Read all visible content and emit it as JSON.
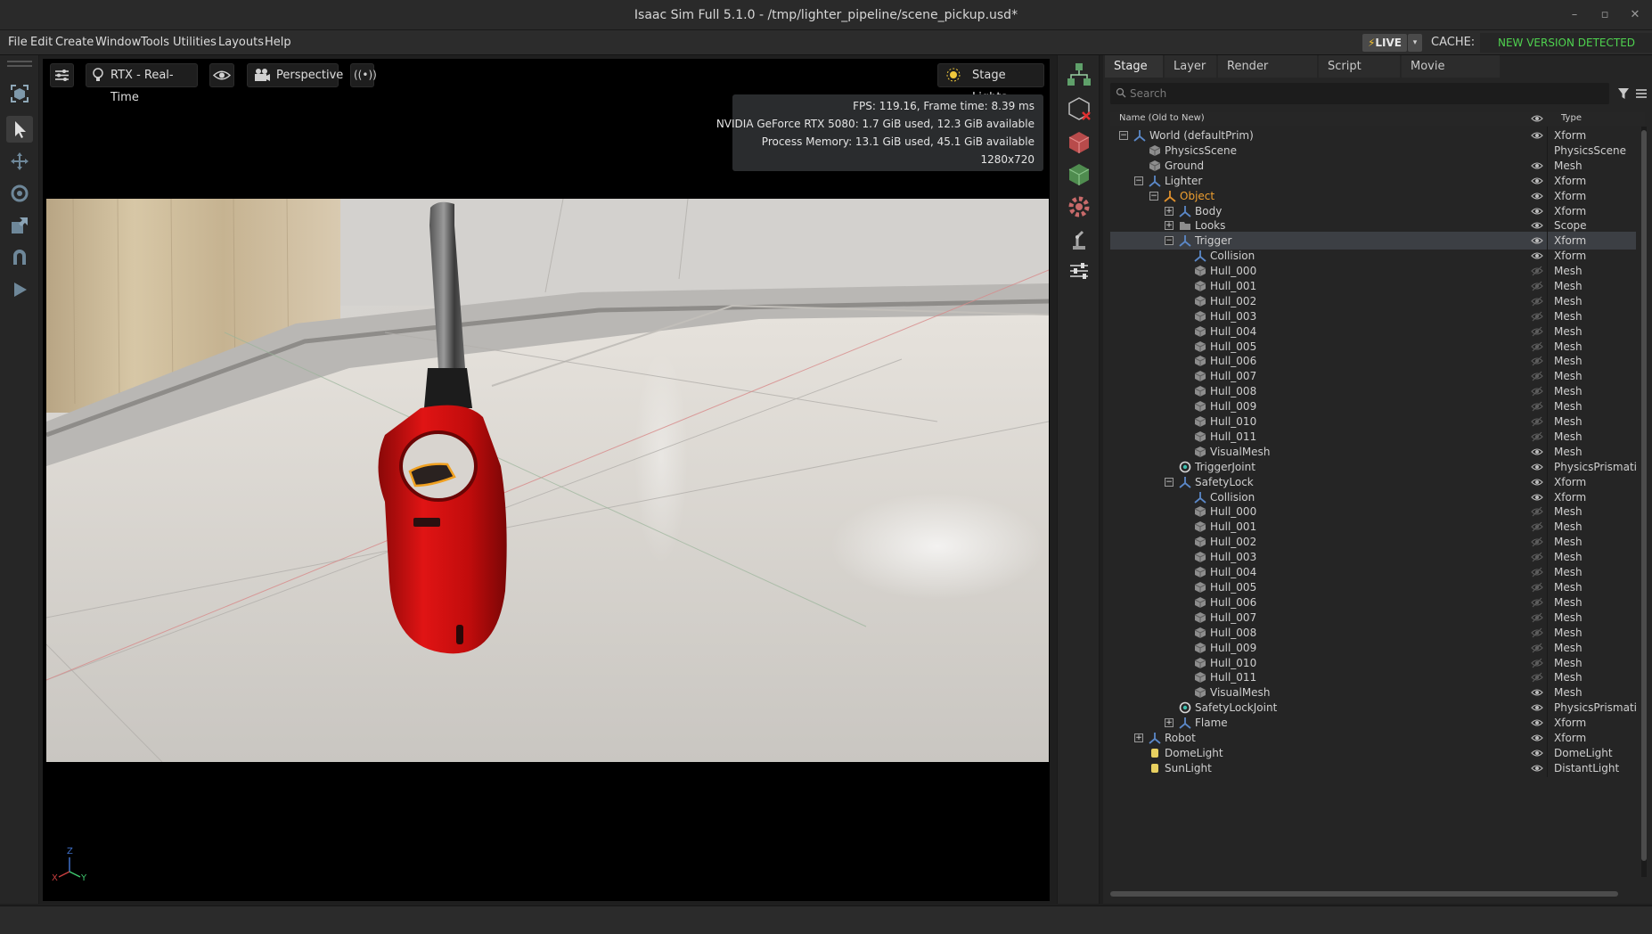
{
  "window": {
    "title": "Isaac Sim Full 5.1.0 - /tmp/lighter_pipeline/scene_pickup.usd*",
    "minimize": "–",
    "maximize": "▫",
    "close": "✕"
  },
  "menu": [
    "File",
    "Edit",
    "Create",
    "Window",
    "Tools",
    "Utilities",
    "Layouts",
    "Help"
  ],
  "live": {
    "label": "LIVE",
    "caret": "▾"
  },
  "cache": {
    "label": "CACHE:",
    "status": "NEW VERSION DETECTED",
    "status_color": "#4fd24f"
  },
  "left_tools": [
    "viewport-camera-icon",
    "select-arrow-icon",
    "move-icon",
    "rotate-icon",
    "scale-icon",
    "snap-magnet-icon",
    "play-icon"
  ],
  "viewport": {
    "renderer": "RTX - Real-Time",
    "camera": "Perspective",
    "lights": "Stage Lights",
    "stats": [
      "FPS: 119.16, Frame time: 8.39 ms",
      "NVIDIA GeForce RTX 5080: 1.7 GiB used, 12.3 GiB available",
      "Process Memory: 13.1 GiB used, 45.1 GiB available",
      "1280x720"
    ],
    "axis": {
      "x": "X",
      "y": "Y",
      "z": "Z"
    }
  },
  "mid_tools": [
    "hierarchy-icon",
    "delete-prim-icon",
    "red-cube-icon",
    "green-cube-icon",
    "gear-icon",
    "robot-arm-icon",
    "sliders-icon"
  ],
  "stage": {
    "tabs": [
      "Stage",
      "Layer",
      "Render Settings",
      "Script Editor",
      "Movie Capture"
    ],
    "active_tab": 0,
    "search_placeholder": "Search",
    "col_name": "Name (Old to New)",
    "col_type": "Type",
    "rows": [
      {
        "name": "World (defaultPrim)",
        "type": "Xform",
        "depth": 0,
        "icon": "xform",
        "exp": "−",
        "eye": "on"
      },
      {
        "name": "PhysicsScene",
        "type": "PhysicsScene",
        "depth": 1,
        "icon": "mesh",
        "exp": "",
        "eye": ""
      },
      {
        "name": "Ground",
        "type": "Mesh",
        "depth": 1,
        "icon": "mesh",
        "exp": "",
        "eye": "on"
      },
      {
        "name": "Lighter",
        "type": "Xform",
        "depth": 1,
        "icon": "xform",
        "exp": "−",
        "eye": "on"
      },
      {
        "name": "Object",
        "type": "Xform",
        "depth": 2,
        "icon": "xform-orange",
        "exp": "−",
        "eye": "on",
        "highlight": true
      },
      {
        "name": "Body",
        "type": "Xform",
        "depth": 3,
        "icon": "xform",
        "exp": "+",
        "eye": "on"
      },
      {
        "name": "Looks",
        "type": "Scope",
        "depth": 3,
        "icon": "folder",
        "exp": "+",
        "eye": "on"
      },
      {
        "name": "Trigger",
        "type": "Xform",
        "depth": 3,
        "icon": "xform",
        "exp": "−",
        "eye": "on",
        "selected": true
      },
      {
        "name": "Collision",
        "type": "Xform",
        "depth": 4,
        "icon": "xform",
        "exp": "",
        "eye": "on"
      },
      {
        "name": "Hull_000",
        "type": "Mesh",
        "depth": 4,
        "icon": "mesh",
        "exp": "",
        "eye": "off"
      },
      {
        "name": "Hull_001",
        "type": "Mesh",
        "depth": 4,
        "icon": "mesh",
        "exp": "",
        "eye": "off"
      },
      {
        "name": "Hull_002",
        "type": "Mesh",
        "depth": 4,
        "icon": "mesh",
        "exp": "",
        "eye": "off"
      },
      {
        "name": "Hull_003",
        "type": "Mesh",
        "depth": 4,
        "icon": "mesh",
        "exp": "",
        "eye": "off"
      },
      {
        "name": "Hull_004",
        "type": "Mesh",
        "depth": 4,
        "icon": "mesh",
        "exp": "",
        "eye": "off"
      },
      {
        "name": "Hull_005",
        "type": "Mesh",
        "depth": 4,
        "icon": "mesh",
        "exp": "",
        "eye": "off"
      },
      {
        "name": "Hull_006",
        "type": "Mesh",
        "depth": 4,
        "icon": "mesh",
        "exp": "",
        "eye": "off"
      },
      {
        "name": "Hull_007",
        "type": "Mesh",
        "depth": 4,
        "icon": "mesh",
        "exp": "",
        "eye": "off"
      },
      {
        "name": "Hull_008",
        "type": "Mesh",
        "depth": 4,
        "icon": "mesh",
        "exp": "",
        "eye": "off"
      },
      {
        "name": "Hull_009",
        "type": "Mesh",
        "depth": 4,
        "icon": "mesh",
        "exp": "",
        "eye": "off"
      },
      {
        "name": "Hull_010",
        "type": "Mesh",
        "depth": 4,
        "icon": "mesh",
        "exp": "",
        "eye": "off"
      },
      {
        "name": "Hull_011",
        "type": "Mesh",
        "depth": 4,
        "icon": "mesh",
        "exp": "",
        "eye": "off"
      },
      {
        "name": "VisualMesh",
        "type": "Mesh",
        "depth": 4,
        "icon": "mesh",
        "exp": "",
        "eye": "on"
      },
      {
        "name": "TriggerJoint",
        "type": "PhysicsPrismatic",
        "depth": 3,
        "icon": "joint",
        "exp": "",
        "eye": "on"
      },
      {
        "name": "SafetyLock",
        "type": "Xform",
        "depth": 3,
        "icon": "xform",
        "exp": "−",
        "eye": "on"
      },
      {
        "name": "Collision",
        "type": "Xform",
        "depth": 4,
        "icon": "xform",
        "exp": "",
        "eye": "on"
      },
      {
        "name": "Hull_000",
        "type": "Mesh",
        "depth": 4,
        "icon": "mesh",
        "exp": "",
        "eye": "off"
      },
      {
        "name": "Hull_001",
        "type": "Mesh",
        "depth": 4,
        "icon": "mesh",
        "exp": "",
        "eye": "off"
      },
      {
        "name": "Hull_002",
        "type": "Mesh",
        "depth": 4,
        "icon": "mesh",
        "exp": "",
        "eye": "off"
      },
      {
        "name": "Hull_003",
        "type": "Mesh",
        "depth": 4,
        "icon": "mesh",
        "exp": "",
        "eye": "off"
      },
      {
        "name": "Hull_004",
        "type": "Mesh",
        "depth": 4,
        "icon": "mesh",
        "exp": "",
        "eye": "off"
      },
      {
        "name": "Hull_005",
        "type": "Mesh",
        "depth": 4,
        "icon": "mesh",
        "exp": "",
        "eye": "off"
      },
      {
        "name": "Hull_006",
        "type": "Mesh",
        "depth": 4,
        "icon": "mesh",
        "exp": "",
        "eye": "off"
      },
      {
        "name": "Hull_007",
        "type": "Mesh",
        "depth": 4,
        "icon": "mesh",
        "exp": "",
        "eye": "off"
      },
      {
        "name": "Hull_008",
        "type": "Mesh",
        "depth": 4,
        "icon": "mesh",
        "exp": "",
        "eye": "off"
      },
      {
        "name": "Hull_009",
        "type": "Mesh",
        "depth": 4,
        "icon": "mesh",
        "exp": "",
        "eye": "off"
      },
      {
        "name": "Hull_010",
        "type": "Mesh",
        "depth": 4,
        "icon": "mesh",
        "exp": "",
        "eye": "off"
      },
      {
        "name": "Hull_011",
        "type": "Mesh",
        "depth": 4,
        "icon": "mesh",
        "exp": "",
        "eye": "off"
      },
      {
        "name": "VisualMesh",
        "type": "Mesh",
        "depth": 4,
        "icon": "mesh",
        "exp": "",
        "eye": "on"
      },
      {
        "name": "SafetyLockJoint",
        "type": "PhysicsPrismatic",
        "depth": 3,
        "icon": "joint",
        "exp": "",
        "eye": "on"
      },
      {
        "name": "Flame",
        "type": "Xform",
        "depth": 3,
        "icon": "xform",
        "exp": "+",
        "eye": "on"
      },
      {
        "name": "Robot",
        "type": "Xform",
        "depth": 1,
        "icon": "xform",
        "exp": "+",
        "eye": "on"
      },
      {
        "name": "DomeLight",
        "type": "DomeLight",
        "depth": 1,
        "icon": "light",
        "exp": "",
        "eye": "on"
      },
      {
        "name": "SunLight",
        "type": "DistantLight",
        "depth": 1,
        "icon": "light",
        "exp": "",
        "eye": "on"
      }
    ]
  }
}
